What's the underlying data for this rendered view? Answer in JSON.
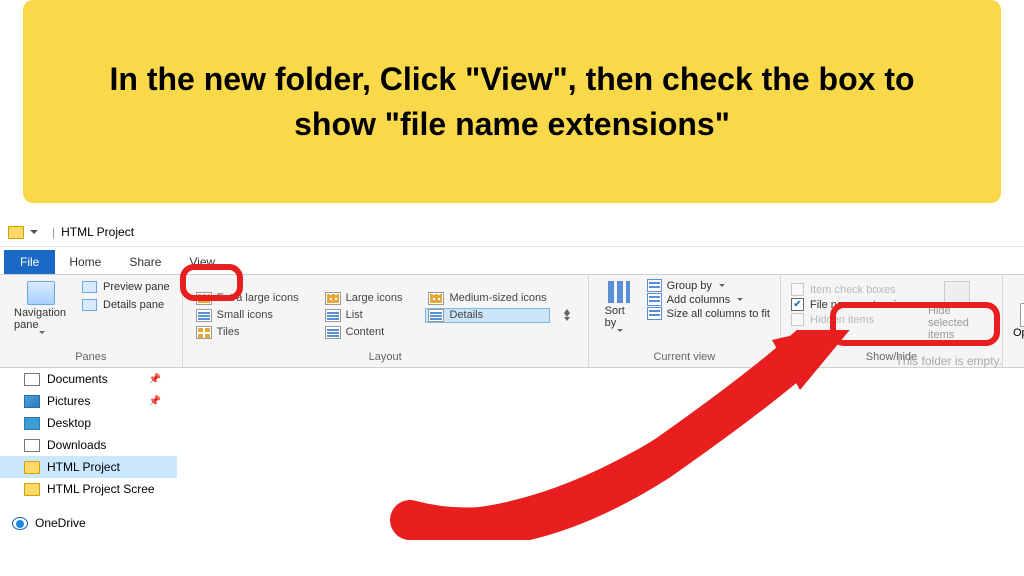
{
  "banner": {
    "text": "In the new folder, Click \"View\", then check the box to show \"file name extensions\""
  },
  "titlebar": {
    "title": "HTML Project"
  },
  "tabs": {
    "file": "File",
    "home": "Home",
    "share": "Share",
    "view": "View"
  },
  "ribbon": {
    "panes": {
      "navigation": "Navigation pane",
      "preview": "Preview pane",
      "details": "Details pane",
      "label": "Panes"
    },
    "layout": {
      "items": [
        "Extra large icons",
        "Large icons",
        "Medium-sized icons",
        "Small icons",
        "List",
        "Details",
        "Tiles",
        "Content"
      ],
      "label": "Layout"
    },
    "currentview": {
      "sort": "Sort by",
      "group": "Group by",
      "addcols": "Add columns",
      "sizeall": "Size all columns to fit",
      "label": "Current view"
    },
    "showhide": {
      "itemcheck": "Item check boxes",
      "ext": "File name extensions",
      "hidden": "Hidden items",
      "hidesel": "Hide selected items",
      "label": "Show/hide"
    },
    "options": "Options"
  },
  "sidebar": {
    "documents": "Documents",
    "pictures": "Pictures",
    "desktop": "Desktop",
    "downloads": "Downloads",
    "htmlproject": "HTML Project",
    "htmlscree": "HTML Project Scree",
    "onedrive": "OneDrive"
  },
  "content": {
    "empty": "This folder is empty."
  }
}
